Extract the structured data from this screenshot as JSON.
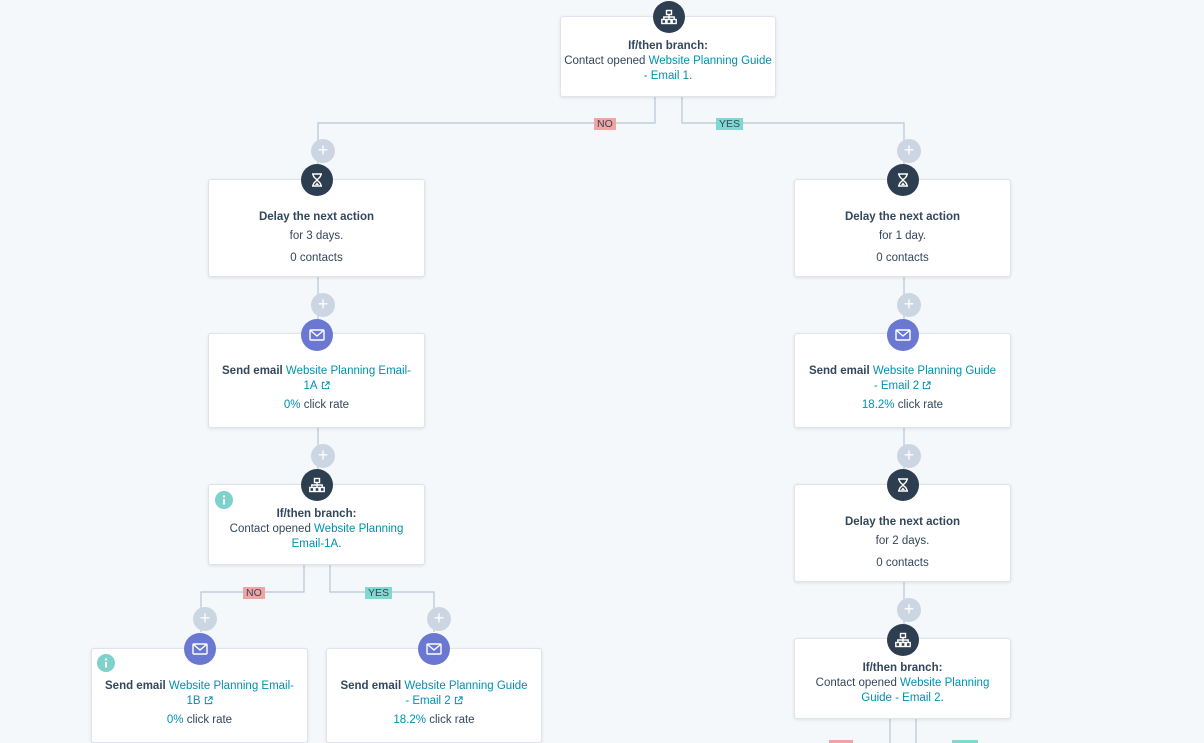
{
  "top_branch": {
    "title": "If/then branch:",
    "prefix": "Contact opened ",
    "link": "Website Planning Guide - Email 1",
    "suffix": "."
  },
  "labels": {
    "no": "NO",
    "yes": "YES",
    "plus": "+"
  },
  "left_delay": {
    "title": "Delay the next action",
    "detail": "for 3 days.",
    "contacts": "0 contacts"
  },
  "right_delay": {
    "title": "Delay the next action",
    "detail": "for 1 day.",
    "contacts": "0 contacts"
  },
  "left_email": {
    "prefix": "Send email ",
    "link": "Website Planning Email-1A",
    "rate": "0%",
    "rate_label": " click rate"
  },
  "right_email": {
    "prefix": "Send email ",
    "link": "Website Planning Guide - Email 2",
    "rate": "18.2%",
    "rate_label": " click rate"
  },
  "left_branch": {
    "title": "If/then branch:",
    "prefix": "Contact opened ",
    "link": "Website Planning Email-1A",
    "suffix": "."
  },
  "right_delay2": {
    "title": "Delay the next action",
    "detail": "for 2 days.",
    "contacts": "0 contacts"
  },
  "ll_email": {
    "prefix": "Send email ",
    "link": "Website Planning Email-1B",
    "rate": "0%",
    "rate_label": " click rate"
  },
  "lr_email": {
    "prefix": "Send email ",
    "link": "Website Planning Guide - Email 2",
    "rate": "18.2%",
    "rate_label": " click rate"
  },
  "right_branch": {
    "title": "If/then branch:",
    "prefix": "Contact opened ",
    "link": "Website Planning Guide - Email 2",
    "suffix": "."
  },
  "colors": {
    "dark_icon": "#2d3e50",
    "email_icon": "#6a78d1",
    "link": "#0091ae",
    "no_tag": "#f2a4a3",
    "yes_tag": "#7fd9d1"
  }
}
